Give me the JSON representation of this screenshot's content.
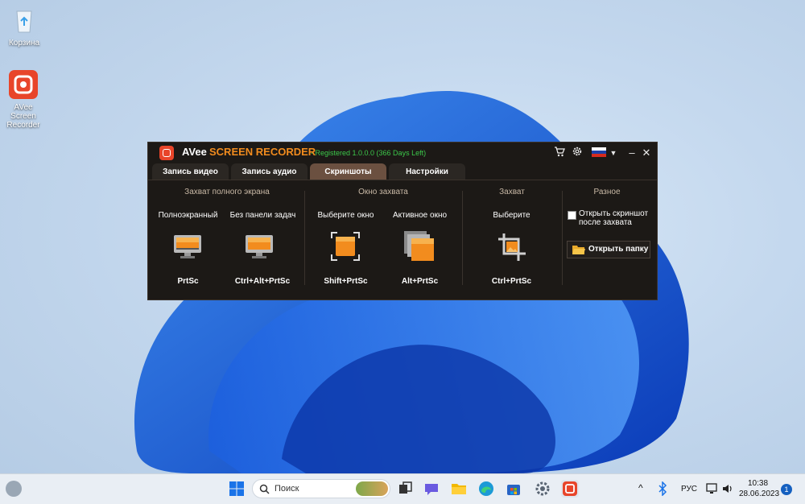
{
  "desktop": {
    "icons": [
      {
        "label": "Корзина"
      },
      {
        "label": "AVee Screen Recorder"
      }
    ]
  },
  "app": {
    "name_part1": "AVee",
    "name_part2": "SCREEN RECORDER",
    "registration": "- Registered 1.0.0.0 (366 Days Left)",
    "accent_color": "#f28c1e",
    "tabs": [
      {
        "label": "Запись видео",
        "active": false
      },
      {
        "label": "Запись аудио",
        "active": false
      },
      {
        "label": "Скриншоты",
        "active": true
      },
      {
        "label": "Настройки",
        "active": false
      }
    ],
    "sections": {
      "full": {
        "title": "Захват полного экрана",
        "items": [
          {
            "label": "Полноэкранный",
            "hotkey": "PrtSc",
            "icon": "monitor-icon"
          },
          {
            "label": "Без панели задач",
            "hotkey": "Ctrl+Alt+PrtSc",
            "icon": "monitor-no-taskbar-icon"
          }
        ]
      },
      "window": {
        "title": "Окно захвата",
        "items": [
          {
            "label": "Выберите окно",
            "hotkey": "Shift+PrtSc",
            "icon": "select-window-icon"
          },
          {
            "label": "Активное окно",
            "hotkey": "Alt+PrtSc",
            "icon": "active-window-icon"
          }
        ]
      },
      "capture": {
        "title": "Захват",
        "items": [
          {
            "label": "Выберите",
            "hotkey": "Ctrl+PrtSc",
            "icon": "crop-region-icon"
          }
        ]
      },
      "misc": {
        "title": "Разное",
        "checkbox_label": "Открыть скриншот после захвата",
        "checkbox_checked": false,
        "open_folder_label": "Открыть папку"
      }
    }
  },
  "taskbar": {
    "search_placeholder": "Поиск",
    "language": "РУС",
    "time": "10:38",
    "date": "28.06.2023",
    "notification_count": "1"
  }
}
